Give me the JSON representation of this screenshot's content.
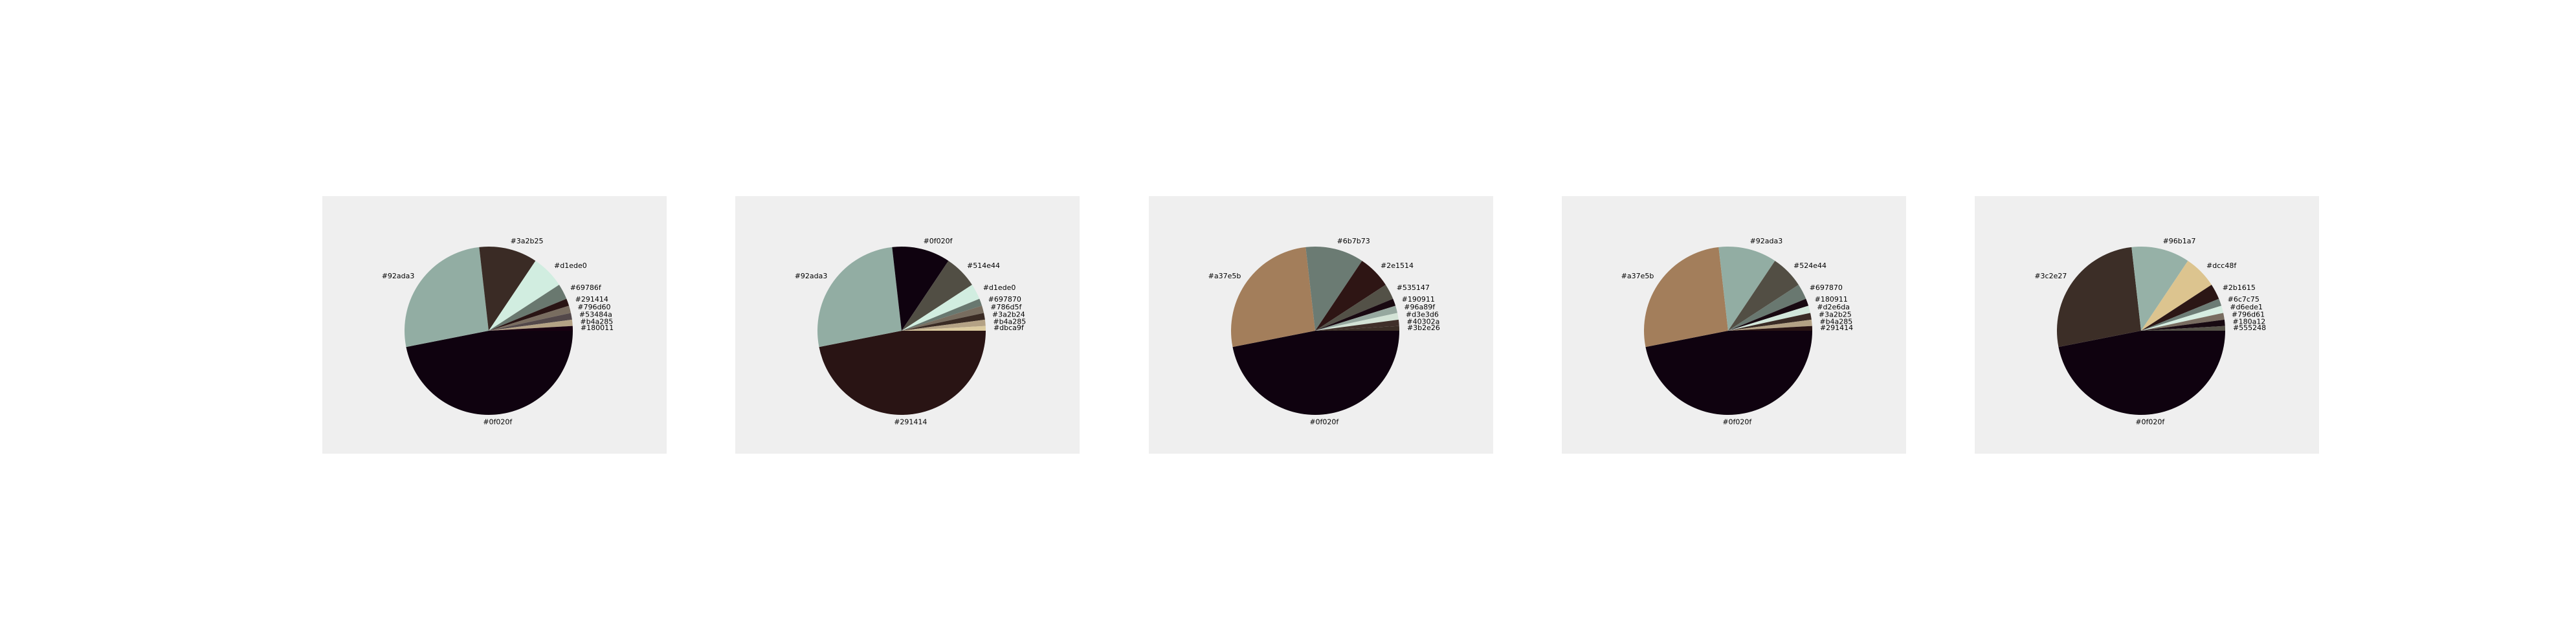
{
  "chart_data": [
    {
      "type": "pie",
      "start_angle_deg": 0,
      "slices": [
        {
          "label": "#0f020f",
          "color": "#0f020f",
          "value": 46.9
        },
        {
          "label": "#92ada3",
          "color": "#92ada3",
          "value": 26.3
        },
        {
          "label": "#3a2b25",
          "color": "#3a2b25",
          "value": 11.2
        },
        {
          "label": "#d1ede0",
          "color": "#d1ede0",
          "value": 6.4
        },
        {
          "label": "#69786f",
          "color": "#69786f",
          "value": 3.0
        },
        {
          "label": "#291414",
          "color": "#291414",
          "value": 1.4
        },
        {
          "label": "#796d60",
          "color": "#796d60",
          "value": 1.4
        },
        {
          "label": "#53484a",
          "color": "#53484a",
          "value": 1.3
        },
        {
          "label": "#b4a285",
          "color": "#b4a285",
          "value": 1.2
        },
        {
          "label": "#180011",
          "color": "#180011",
          "value": 0.9
        }
      ]
    },
    {
      "type": "pie",
      "start_angle_deg": 0,
      "slices": [
        {
          "label": "#291414",
          "color": "#291414",
          "value": 46.9
        },
        {
          "label": "#92ada3",
          "color": "#92ada3",
          "value": 26.3
        },
        {
          "label": "#0f020f",
          "color": "#0f020f",
          "value": 11.2
        },
        {
          "label": "#514e44",
          "color": "#514e44",
          "value": 6.4
        },
        {
          "label": "#d1ede0",
          "color": "#d1ede0",
          "value": 3.0
        },
        {
          "label": "#697870",
          "color": "#697870",
          "value": 1.4
        },
        {
          "label": "#786d5f",
          "color": "#786d5f",
          "value": 1.4
        },
        {
          "label": "#3a2b24",
          "color": "#3a2b24",
          "value": 1.3
        },
        {
          "label": "#b4a285",
          "color": "#b4a285",
          "value": 1.2
        },
        {
          "label": "#dbca9f",
          "color": "#dbca9f",
          "value": 0.9
        }
      ]
    },
    {
      "type": "pie",
      "start_angle_deg": 0,
      "slices": [
        {
          "label": "#0f020f",
          "color": "#0f020f",
          "value": 46.9
        },
        {
          "label": "#a37e5b",
          "color": "#a37e5b",
          "value": 26.3
        },
        {
          "label": "#6b7b73",
          "color": "#6b7b73",
          "value": 11.2
        },
        {
          "label": "#2e1514",
          "color": "#2e1514",
          "value": 6.4
        },
        {
          "label": "#535147",
          "color": "#535147",
          "value": 3.0
        },
        {
          "label": "#190911",
          "color": "#190911",
          "value": 1.4
        },
        {
          "label": "#96a89f",
          "color": "#96a89f",
          "value": 1.4
        },
        {
          "label": "#d3e3d6",
          "color": "#d3e3d6",
          "value": 1.3
        },
        {
          "label": "#40302a",
          "color": "#40302a",
          "value": 1.2
        },
        {
          "label": "#3b2e26",
          "color": "#3b2e26",
          "value": 0.9
        }
      ]
    },
    {
      "type": "pie",
      "start_angle_deg": 0,
      "slices": [
        {
          "label": "#0f020f",
          "color": "#0f020f",
          "value": 46.9
        },
        {
          "label": "#a37e5b",
          "color": "#a37e5b",
          "value": 26.3
        },
        {
          "label": "#92ada3",
          "color": "#92ada3",
          "value": 11.2
        },
        {
          "label": "#524e44",
          "color": "#524e44",
          "value": 6.4
        },
        {
          "label": "#697870",
          "color": "#697870",
          "value": 3.0
        },
        {
          "label": "#180911",
          "color": "#180911",
          "value": 1.4
        },
        {
          "label": "#d2e6da",
          "color": "#d2e6da",
          "value": 1.4
        },
        {
          "label": "#3a2b25",
          "color": "#3a2b25",
          "value": 1.3
        },
        {
          "label": "#b4a285",
          "color": "#b4a285",
          "value": 1.2
        },
        {
          "label": "#291414",
          "color": "#291414",
          "value": 0.9
        }
      ]
    },
    {
      "type": "pie",
      "start_angle_deg": 0,
      "slices": [
        {
          "label": "#0f020f",
          "color": "#0f020f",
          "value": 46.9
        },
        {
          "label": "#3c2e27",
          "color": "#3c2e27",
          "value": 26.3
        },
        {
          "label": "#96b1a7",
          "color": "#96b1a7",
          "value": 11.2
        },
        {
          "label": "#dcc48f",
          "color": "#dcc48f",
          "value": 6.4
        },
        {
          "label": "#2b1615",
          "color": "#2b1615",
          "value": 3.0
        },
        {
          "label": "#6c7c75",
          "color": "#6c7c75",
          "value": 1.4
        },
        {
          "label": "#d6ede1",
          "color": "#d6ede1",
          "value": 1.4
        },
        {
          "label": "#796d61",
          "color": "#796d61",
          "value": 1.3
        },
        {
          "label": "#180a12",
          "color": "#180a12",
          "value": 1.2
        },
        {
          "label": "#555248",
          "color": "#555248",
          "value": 0.9
        }
      ]
    }
  ]
}
